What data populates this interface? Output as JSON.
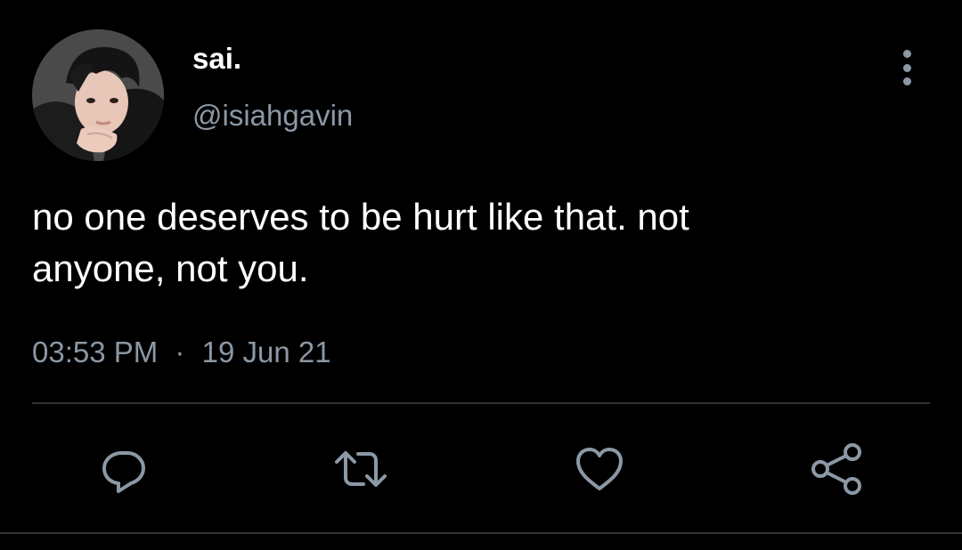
{
  "tweet": {
    "display_name": "sai.",
    "handle": "@isiahgavin",
    "text": "no one deserves to be hurt like that. not\nanyone, not you.",
    "time": "03:53 PM",
    "separator": "·",
    "date": "19 Jun 21"
  },
  "actions": [
    {
      "name": "reply",
      "icon": "reply-icon"
    },
    {
      "name": "retweet",
      "icon": "retweet-icon"
    },
    {
      "name": "like",
      "icon": "heart-icon"
    },
    {
      "name": "share",
      "icon": "share-icon"
    }
  ],
  "colors": {
    "background": "#000000",
    "primary_text": "#ffffff",
    "secondary_text": "#8b98a5",
    "divider": "#2f3336"
  }
}
